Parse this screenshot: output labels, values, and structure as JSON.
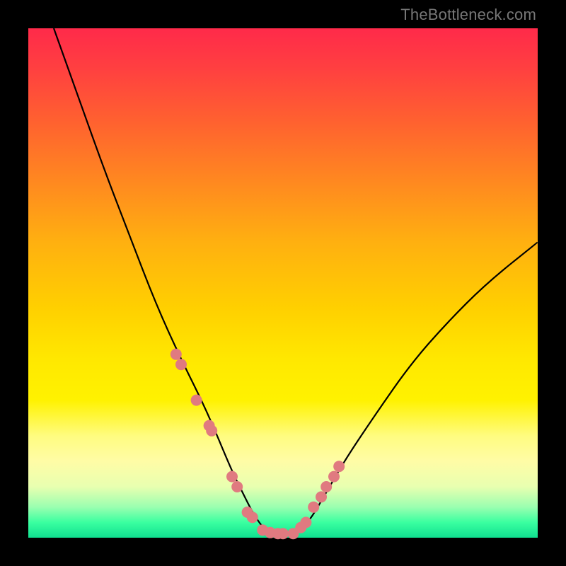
{
  "watermark": "TheBottleneck.com",
  "chart_data": {
    "type": "line",
    "title": "",
    "xlabel": "",
    "ylabel": "",
    "xlim": [
      0,
      100
    ],
    "ylim": [
      0,
      100
    ],
    "grid": false,
    "legend": false,
    "series": [
      {
        "name": "bottleneck-curve",
        "x": [
          5,
          10,
          15,
          20,
          25,
          30,
          35,
          40,
          42,
          44,
          46,
          48,
          50,
          52,
          55,
          58,
          62,
          68,
          75,
          82,
          90,
          100
        ],
        "y": [
          100,
          86,
          72,
          59,
          46,
          35,
          25,
          13,
          9,
          5,
          2,
          0.5,
          0.5,
          0.5,
          3,
          8,
          15,
          24,
          34,
          42,
          50,
          58
        ]
      }
    ],
    "scatter_points": {
      "name": "measured-points",
      "x": [
        29,
        30,
        33,
        35.5,
        36,
        40,
        41,
        43,
        44,
        46,
        47.5,
        49,
        50,
        52,
        53.5,
        54.5,
        56,
        57.5,
        58.5,
        60,
        61
      ],
      "y": [
        36,
        34,
        27,
        22,
        21,
        12,
        10,
        5,
        4,
        1.5,
        1,
        0.8,
        0.8,
        0.8,
        2,
        3,
        6,
        8,
        10,
        12,
        14
      ]
    }
  }
}
